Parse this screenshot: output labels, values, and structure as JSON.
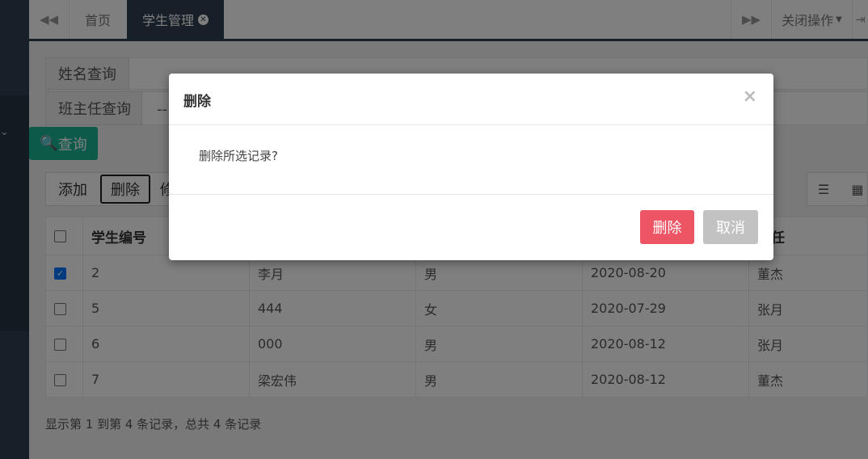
{
  "tabs": {
    "home": "首页",
    "active": "学生管理",
    "close_ops": "关闭操作"
  },
  "search": {
    "name_label": "姓名查询",
    "teacher_label": "班主任查询",
    "teacher_value": "--",
    "query_button": "查询"
  },
  "toolbar": {
    "add": "添加",
    "delete": "删除",
    "edit_partial": "修"
  },
  "table": {
    "columns": [
      "学生编号",
      "",
      "",
      "",
      "班主任"
    ],
    "visible_last_header": "主任",
    "rows": [
      {
        "checked": true,
        "id": "2",
        "name": "李月",
        "gender": "男",
        "date": "2020-08-20",
        "teacher": "董杰"
      },
      {
        "checked": false,
        "id": "5",
        "name": "444",
        "gender": "女",
        "date": "2020-07-29",
        "teacher": "张月"
      },
      {
        "checked": false,
        "id": "6",
        "name": "000",
        "gender": "男",
        "date": "2020-08-12",
        "teacher": "张月"
      },
      {
        "checked": false,
        "id": "7",
        "name": "梁宏伟",
        "gender": "男",
        "date": "2020-08-12",
        "teacher": "董杰"
      }
    ]
  },
  "pager": {
    "info": "显示第 1 到第 4 条记录，总共 4 条记录"
  },
  "modal": {
    "title": "删除",
    "close": "×",
    "message": "删除所选记录?",
    "confirm": "删除",
    "cancel": "取消"
  },
  "colors": {
    "sidebar": "#2f4050",
    "danger": "#ed5565",
    "cancel": "#c2c2c2"
  }
}
